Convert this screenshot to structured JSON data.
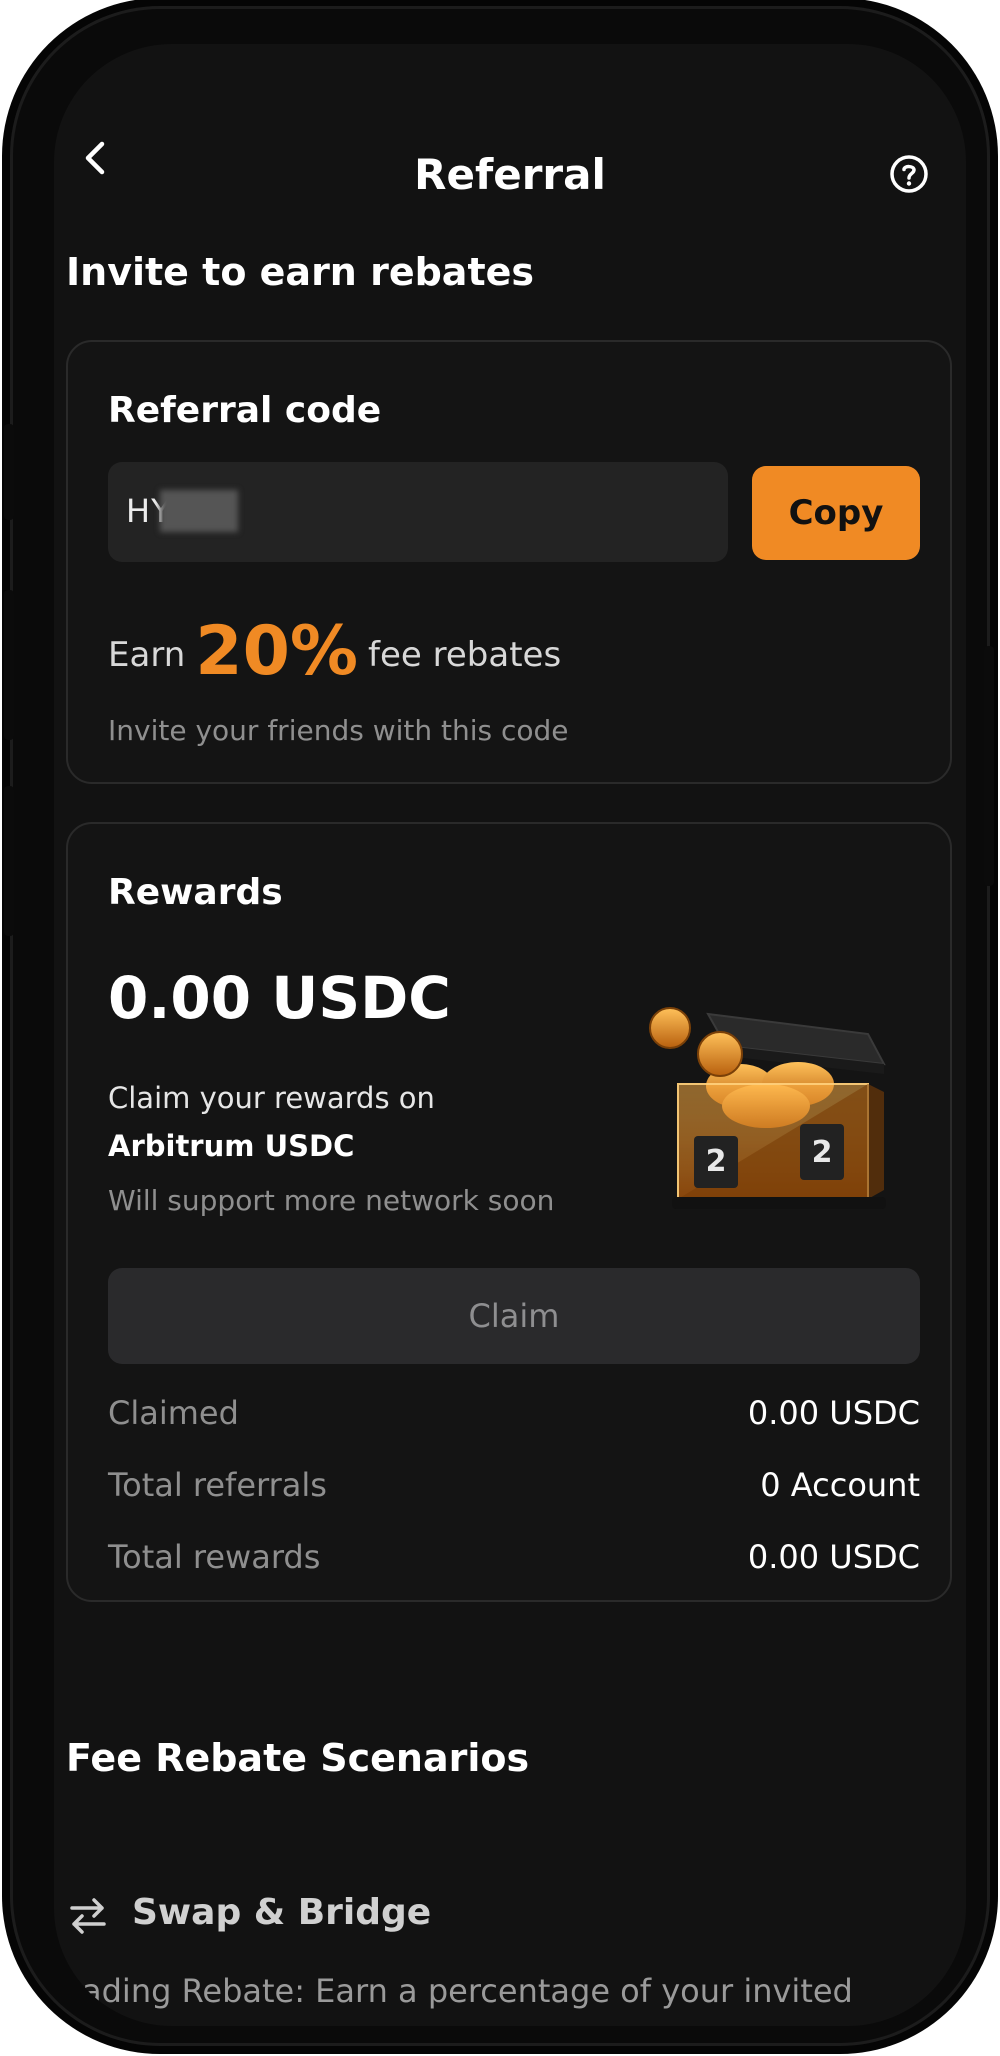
{
  "header": {
    "title": "Referral",
    "back_icon": "chevron-left-icon",
    "help_icon": "question-circle-icon"
  },
  "invite": {
    "heading": "Invite to earn rebates",
    "card_title": "Referral code",
    "code_value": "HY PE",
    "copy_label": "Copy",
    "earn_prefix": "Earn",
    "earn_percent": "20%",
    "earn_suffix": "fee rebates",
    "hint": "Invite your friends with this code"
  },
  "rewards": {
    "title": "Rewards",
    "amount": "0.00 USDC",
    "claim_prefix": "Claim your rewards on",
    "claim_network": "Arbitrum USDC",
    "support_hint": "Will support more network soon",
    "claim_label": "Claim",
    "stats": [
      {
        "label": "Claimed",
        "value": "0.00 USDC"
      },
      {
        "label": "Total referrals",
        "value": "0 Account"
      },
      {
        "label": "Total rewards",
        "value": "0.00 USDC"
      }
    ]
  },
  "scenarios": {
    "heading": "Fee Rebate Scenarios",
    "item_label": "Swap & Bridge",
    "item_icon": "swap-arrows-icon",
    "description": "Trading Rebate: Earn a percentage of your invited"
  },
  "colors": {
    "accent": "#f08a24",
    "background": "#121212",
    "card": "#141414"
  }
}
